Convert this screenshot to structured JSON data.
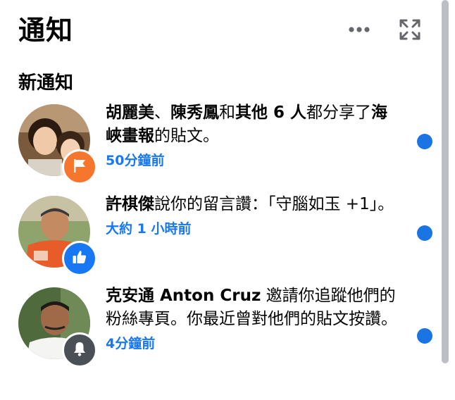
{
  "header": {
    "title": "通知",
    "more_icon": "more-horizontal-icon",
    "expand_icon": "expand-icon"
  },
  "section": {
    "title": "新通知"
  },
  "notifications": [
    {
      "part1": "胡麗美",
      "part2": "、",
      "part3": "陳秀鳳",
      "part4": "和",
      "part5": "其他 6 人",
      "part6": "都分享了",
      "part7": "海峽畫報",
      "part8": "的貼文。",
      "time": "50分鐘前",
      "badge_icon": "flag-icon",
      "badge_color": "#f7762e",
      "unread": true
    },
    {
      "part1": "許棋傑",
      "part2": "說你的留言讚：「守腦如玉 +1」。",
      "time": "大約 1 小時前",
      "badge_icon": "thumbs-up-icon",
      "badge_color": "#1877f2",
      "unread": true
    },
    {
      "part1": "克安通 Anton Cruz",
      "part2": " 邀請你追蹤他們的粉絲專頁。你最近曾對他們的貼文按讚。",
      "time": "4分鐘前",
      "badge_icon": "bell-icon",
      "badge_color": "#4b4f56",
      "unread": true
    }
  ],
  "colors": {
    "accent": "#1877f2",
    "unread_dot": "#1b74e4",
    "text": "#050505",
    "scrollbar": "#bcc0c4"
  }
}
